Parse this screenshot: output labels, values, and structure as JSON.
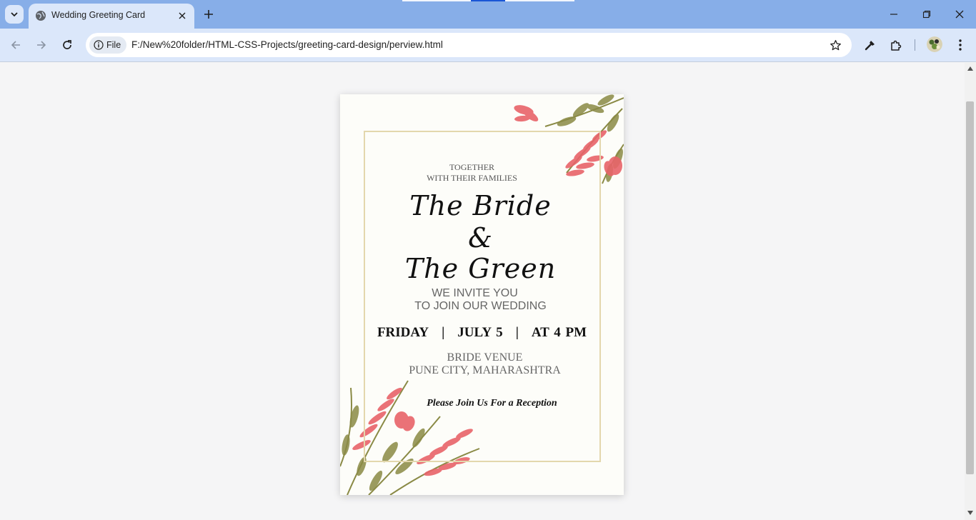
{
  "browser": {
    "tab": {
      "title": "Wedding Greeting Card"
    },
    "address_bar": {
      "chip_label": "File",
      "url": "F:/New%20folder/HTML-CSS-Projects/greeting-card-design/perview.html"
    },
    "accent_color": "#87aee8",
    "toolbar_color": "#dbe7fa",
    "icons": [
      "tab-search-icon",
      "globe-icon",
      "close-icon",
      "plus-icon",
      "minimize-icon",
      "restore-icon",
      "back-arrow-icon",
      "forward-arrow-icon",
      "reload-icon",
      "info-icon",
      "star-icon",
      "eyedropper-icon",
      "puzzle-icon",
      "kebab-menu-icon"
    ]
  },
  "card": {
    "together": "TOGETHER",
    "with_families": "WITH THEIR FAMILIES",
    "bride": "The Bride",
    "ampersand": "&",
    "groom": "The Green",
    "invite_line1": "WE INVITE YOU",
    "invite_line2": "TO JOIN OUR WEDDING",
    "day": "FRIDAY",
    "date": "JULY 5",
    "time": "AT 4 PM",
    "separator": "|",
    "venue_line1": "BRIDE VENUE",
    "venue_line2": "PUNE CITY, MAHARASHTRA",
    "reception": "Please Join Us For a Reception",
    "colors": {
      "frame": "#e3d7ad",
      "petal": "#e8646a",
      "leaf": "#8a8a45",
      "background": "#fdfdf9"
    }
  }
}
